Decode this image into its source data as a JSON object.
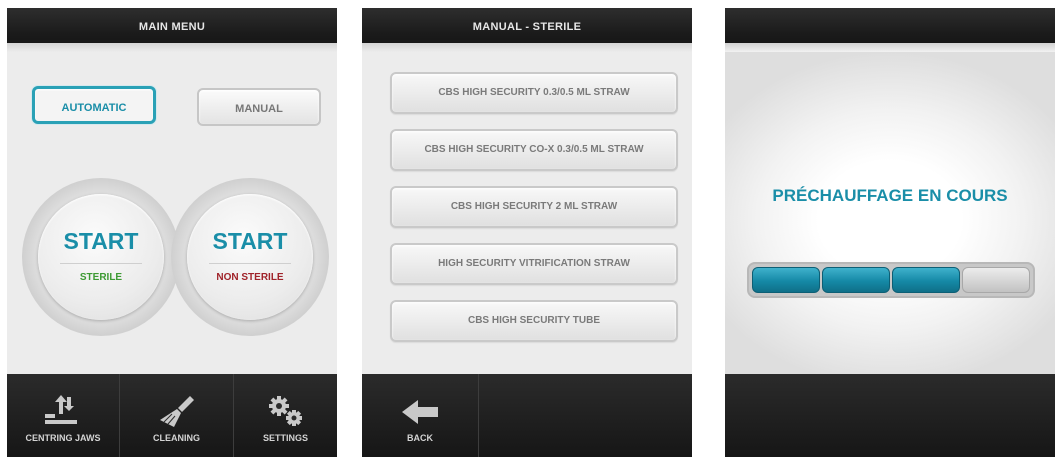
{
  "main_menu": {
    "title": "MAIN MENU",
    "automatic_label": "AUTOMATIC",
    "manual_label": "MANUAL",
    "start_sterile": {
      "label": "START",
      "sub": "STERILE"
    },
    "start_non_sterile": {
      "label": "START",
      "sub": "NON STERILE"
    },
    "footer": [
      {
        "icon": "centring-jaws-icon",
        "label": "CENTRING JAWS"
      },
      {
        "icon": "brush-icon",
        "label": "CLEANING"
      },
      {
        "icon": "gears-icon",
        "label": "SETTINGS"
      }
    ]
  },
  "manual_sterile": {
    "title": "MANUAL - STERILE",
    "items": [
      "CBS HIGH SECURITY 0.3/0.5 ML STRAW",
      "CBS HIGH SECURITY CO-X 0.3/0.5 ML STRAW",
      "CBS HIGH SECURITY 2 ML STRAW",
      "HIGH SECURITY VITRIFICATION STRAW",
      "CBS HIGH SECURITY TUBE"
    ],
    "footer": {
      "icon": "back-arrow-icon",
      "label": "BACK"
    }
  },
  "preheat": {
    "title": "",
    "message": "PRÉCHAUFFAGE EN COURS",
    "progress": {
      "filled_segments": 3,
      "total_segments": 4
    }
  },
  "colors": {
    "accent": "#1a8ea8",
    "sterile_green": "#3d9a33",
    "non_sterile_red": "#a0232a",
    "header_bg": "#1a1a1a"
  }
}
